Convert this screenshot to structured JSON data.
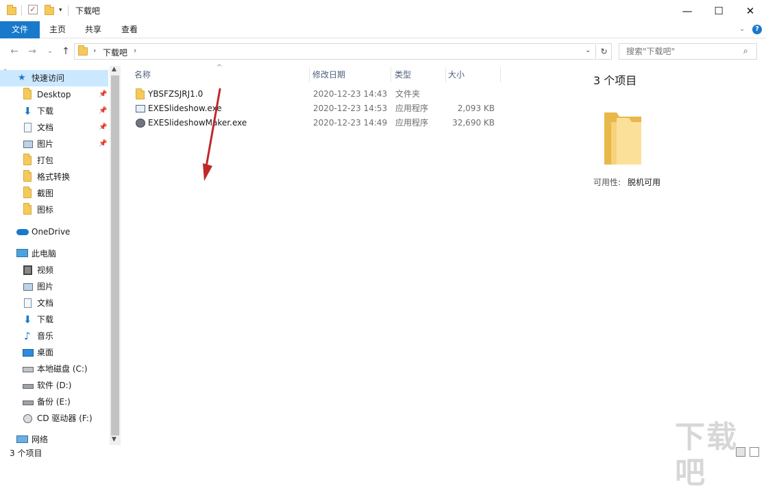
{
  "window": {
    "title": "下载吧",
    "buttons": {
      "minimize": "—",
      "maximize": "☐",
      "close": "✕"
    }
  },
  "ribbon": {
    "tabs": [
      "文件",
      "主页",
      "共享",
      "查看"
    ]
  },
  "address": {
    "path": [
      "下载吧"
    ],
    "search_placeholder": "搜索\"下载吧\""
  },
  "nav": {
    "quick_access": "快速访问",
    "quick_items": [
      "Desktop",
      "下载",
      "文档",
      "图片",
      "打包",
      "格式转换",
      "截图",
      "图标"
    ],
    "onedrive": "OneDrive",
    "this_pc": "此电脑",
    "pc_items": [
      "视频",
      "图片",
      "文档",
      "下载",
      "音乐",
      "桌面",
      "本地磁盘 (C:)",
      "软件 (D:)",
      "备份 (E:)",
      "CD 驱动器 (F:)"
    ],
    "network": "网络"
  },
  "columns": {
    "name": "名称",
    "date": "修改日期",
    "type": "类型",
    "size": "大小"
  },
  "files": [
    {
      "name": "YBSFZSJRJ1.0",
      "date": "2020-12-23 14:43",
      "type": "文件夹",
      "size": ""
    },
    {
      "name": "EXESlideshow.exe",
      "date": "2020-12-23 14:53",
      "type": "应用程序",
      "size": "2,093 KB"
    },
    {
      "name": "EXESlideshowMaker.exe",
      "date": "2020-12-23 14:49",
      "type": "应用程序",
      "size": "32,690 KB"
    }
  ],
  "preview": {
    "count": "3 个项目",
    "availability_label": "可用性:",
    "availability_value": "脱机可用"
  },
  "status": {
    "count": "3 个项目"
  },
  "watermark": {
    "text": "下载吧"
  },
  "colors": {
    "accent": "#1979ca",
    "selected": "#cce8ff",
    "arrow": "#c0282a",
    "folder": "#f5c95b"
  }
}
